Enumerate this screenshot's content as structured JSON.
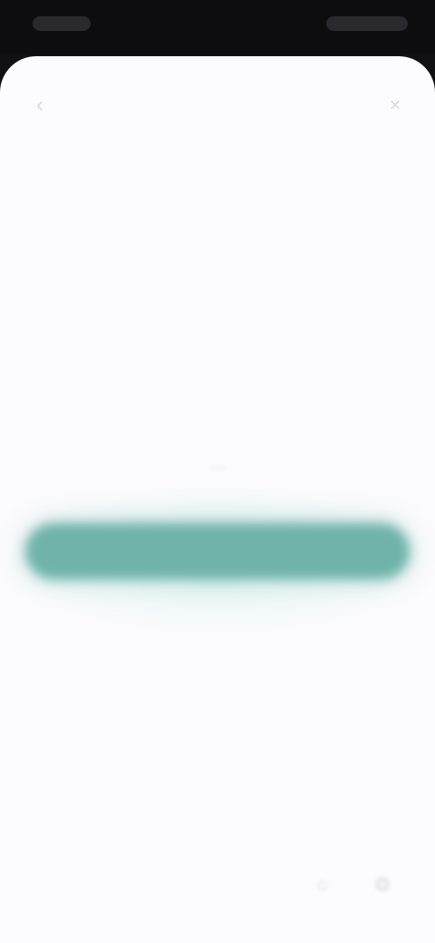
{
  "status_bar": {
    "time": "",
    "indicators": ""
  },
  "header": {
    "back_icon": "chevron-left-icon",
    "title": "",
    "close_icon": "close-icon"
  },
  "main": {
    "brand": "",
    "heading": "",
    "description": "",
    "primary_button_label": "",
    "helper_text": "",
    "secondary_link_label": ""
  },
  "footer": {
    "icons": [
      "circle-icon",
      "gear-icon"
    ]
  },
  "colors": {
    "accent": "#6fb3aa",
    "background": "#fcfbfd",
    "status_bar": "#0d0d10"
  }
}
